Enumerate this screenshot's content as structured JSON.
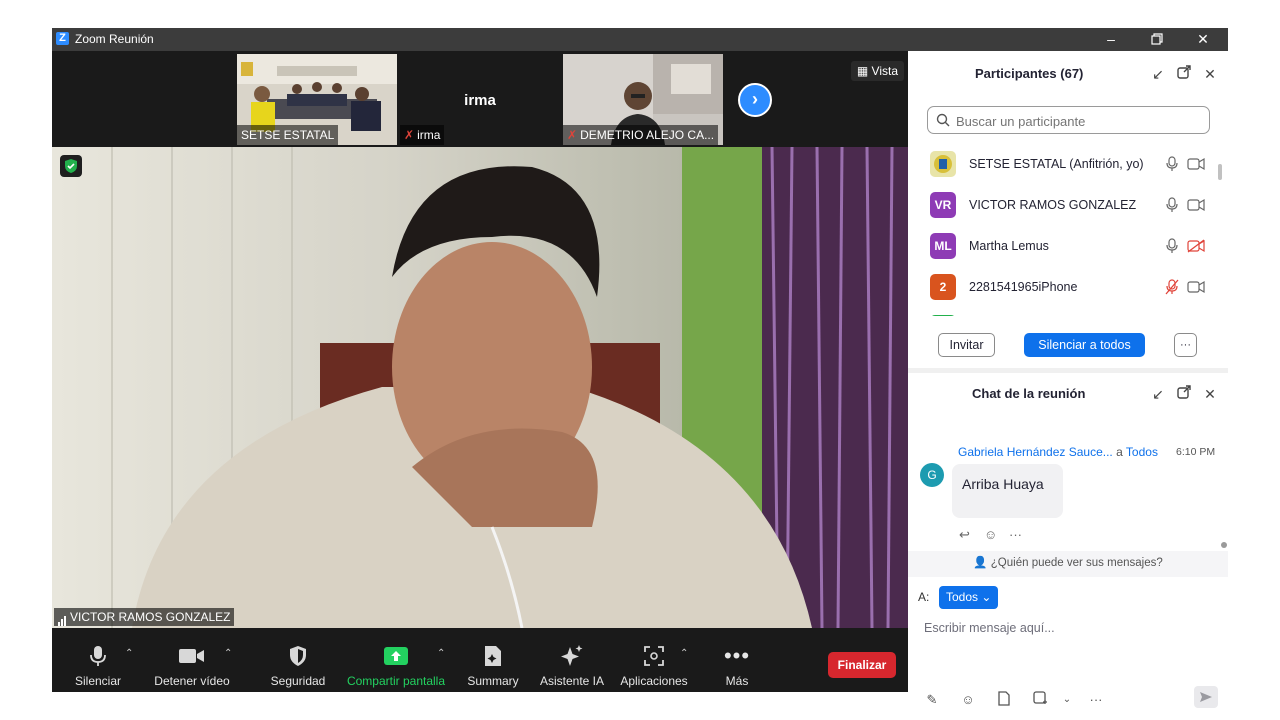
{
  "window": {
    "title": "Zoom Reunión"
  },
  "strip": {
    "thumbs": [
      {
        "name": "SETSE ESTATAL"
      },
      {
        "name": "irma",
        "center_name": "irma"
      },
      {
        "name": "DEMETRIO ALEJO CA..."
      }
    ],
    "vista_label": "Vista"
  },
  "main_video": {
    "speaker_name": "VICTOR RAMOS GONZALEZ"
  },
  "toolbar": {
    "mute_label": "Silenciar",
    "video_label": "Detener vídeo",
    "security_label": "Seguridad",
    "share_label": "Compartir pantalla",
    "summary_label": "Summary",
    "ai_label": "Asistente IA",
    "apps_label": "Aplicaciones",
    "more_label": "Más",
    "end_label": "Finalizar"
  },
  "participants": {
    "title": "Participantes (67)",
    "search_placeholder": "Buscar un participante",
    "list": [
      {
        "initials": "",
        "name": "SETSE ESTATAL (Anfitrión, yo)",
        "color": "#f2f2f2",
        "mic": "on",
        "cam": "on"
      },
      {
        "initials": "VR",
        "name": "VICTOR RAMOS GONZALEZ",
        "color": "#8e3bb5",
        "mic": "on",
        "cam": "on"
      },
      {
        "initials": "ML",
        "name": "Martha Lemus",
        "color": "#8e3bb5",
        "mic": "on",
        "cam": "off"
      },
      {
        "initials": "2",
        "name": "2281541965iPhone",
        "color": "#d9541e",
        "mic": "off",
        "cam": "on"
      }
    ],
    "invite_label": "Invitar",
    "mute_all_label": "Silenciar a todos",
    "more_icon": "···"
  },
  "chat": {
    "title": "Chat de la reunión",
    "message": {
      "sender": "Gabriela Hernández Sauce...",
      "to_prefix": "a",
      "to": "Todos",
      "time": "6:10 PM",
      "avatar": "G",
      "text": "Arriba Huaya"
    },
    "who_can_see": "¿Quién puede ver sus mensajes?",
    "to_label": "A:",
    "recipient": "Todos",
    "input_placeholder": "Escribir mensaje aquí..."
  }
}
